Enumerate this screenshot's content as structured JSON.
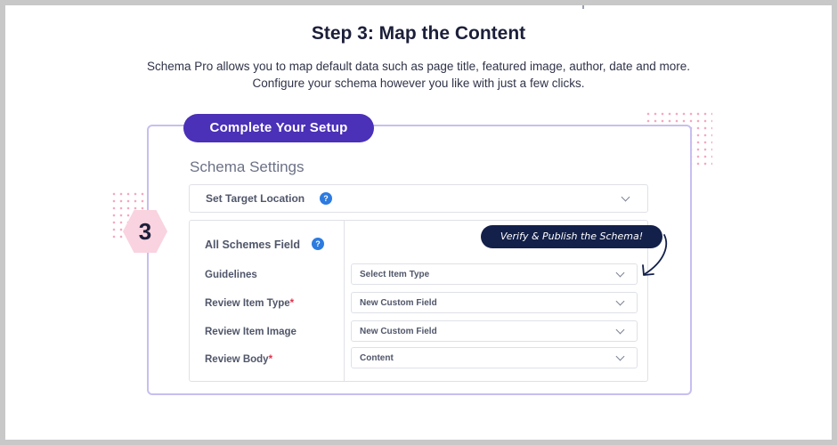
{
  "header": {
    "title": "Step 3: Map the Content",
    "description_line1": "Schema Pro allows you to map default data such as page title, featured image, author, date and more.",
    "description_line2": "Configure your schema however you like with just a few clicks."
  },
  "setup": {
    "pill_label": "Complete Your Setup",
    "step_number": "3"
  },
  "schema_settings": {
    "title": "Schema Settings",
    "target_location_label": "Set Target Location",
    "help_glyph": "?"
  },
  "fields_panel": {
    "heading": "All Schemes Field",
    "rows": [
      {
        "label": "Guidelines",
        "required": "",
        "value": "Select Item Type"
      },
      {
        "label": "Review Item Type",
        "required": "*",
        "value": "New Custom Field"
      },
      {
        "label": "Review Item Image",
        "required": "",
        "value": "New Custom Field"
      },
      {
        "label": "Review Body",
        "required": "*",
        "value": "Content"
      }
    ]
  },
  "callout": {
    "text": "Verify & Publish the Schema!"
  },
  "colors": {
    "accent_purple": "#4b30b8",
    "card_border": "#c7bff0",
    "callout_navy": "#13204a",
    "help_blue": "#2d7be0",
    "hex_pink": "#f9d3df",
    "required_red": "#e0334d"
  },
  "icons": [
    "help-icon",
    "chevron-down-icon",
    "curved-arrow-icon"
  ]
}
